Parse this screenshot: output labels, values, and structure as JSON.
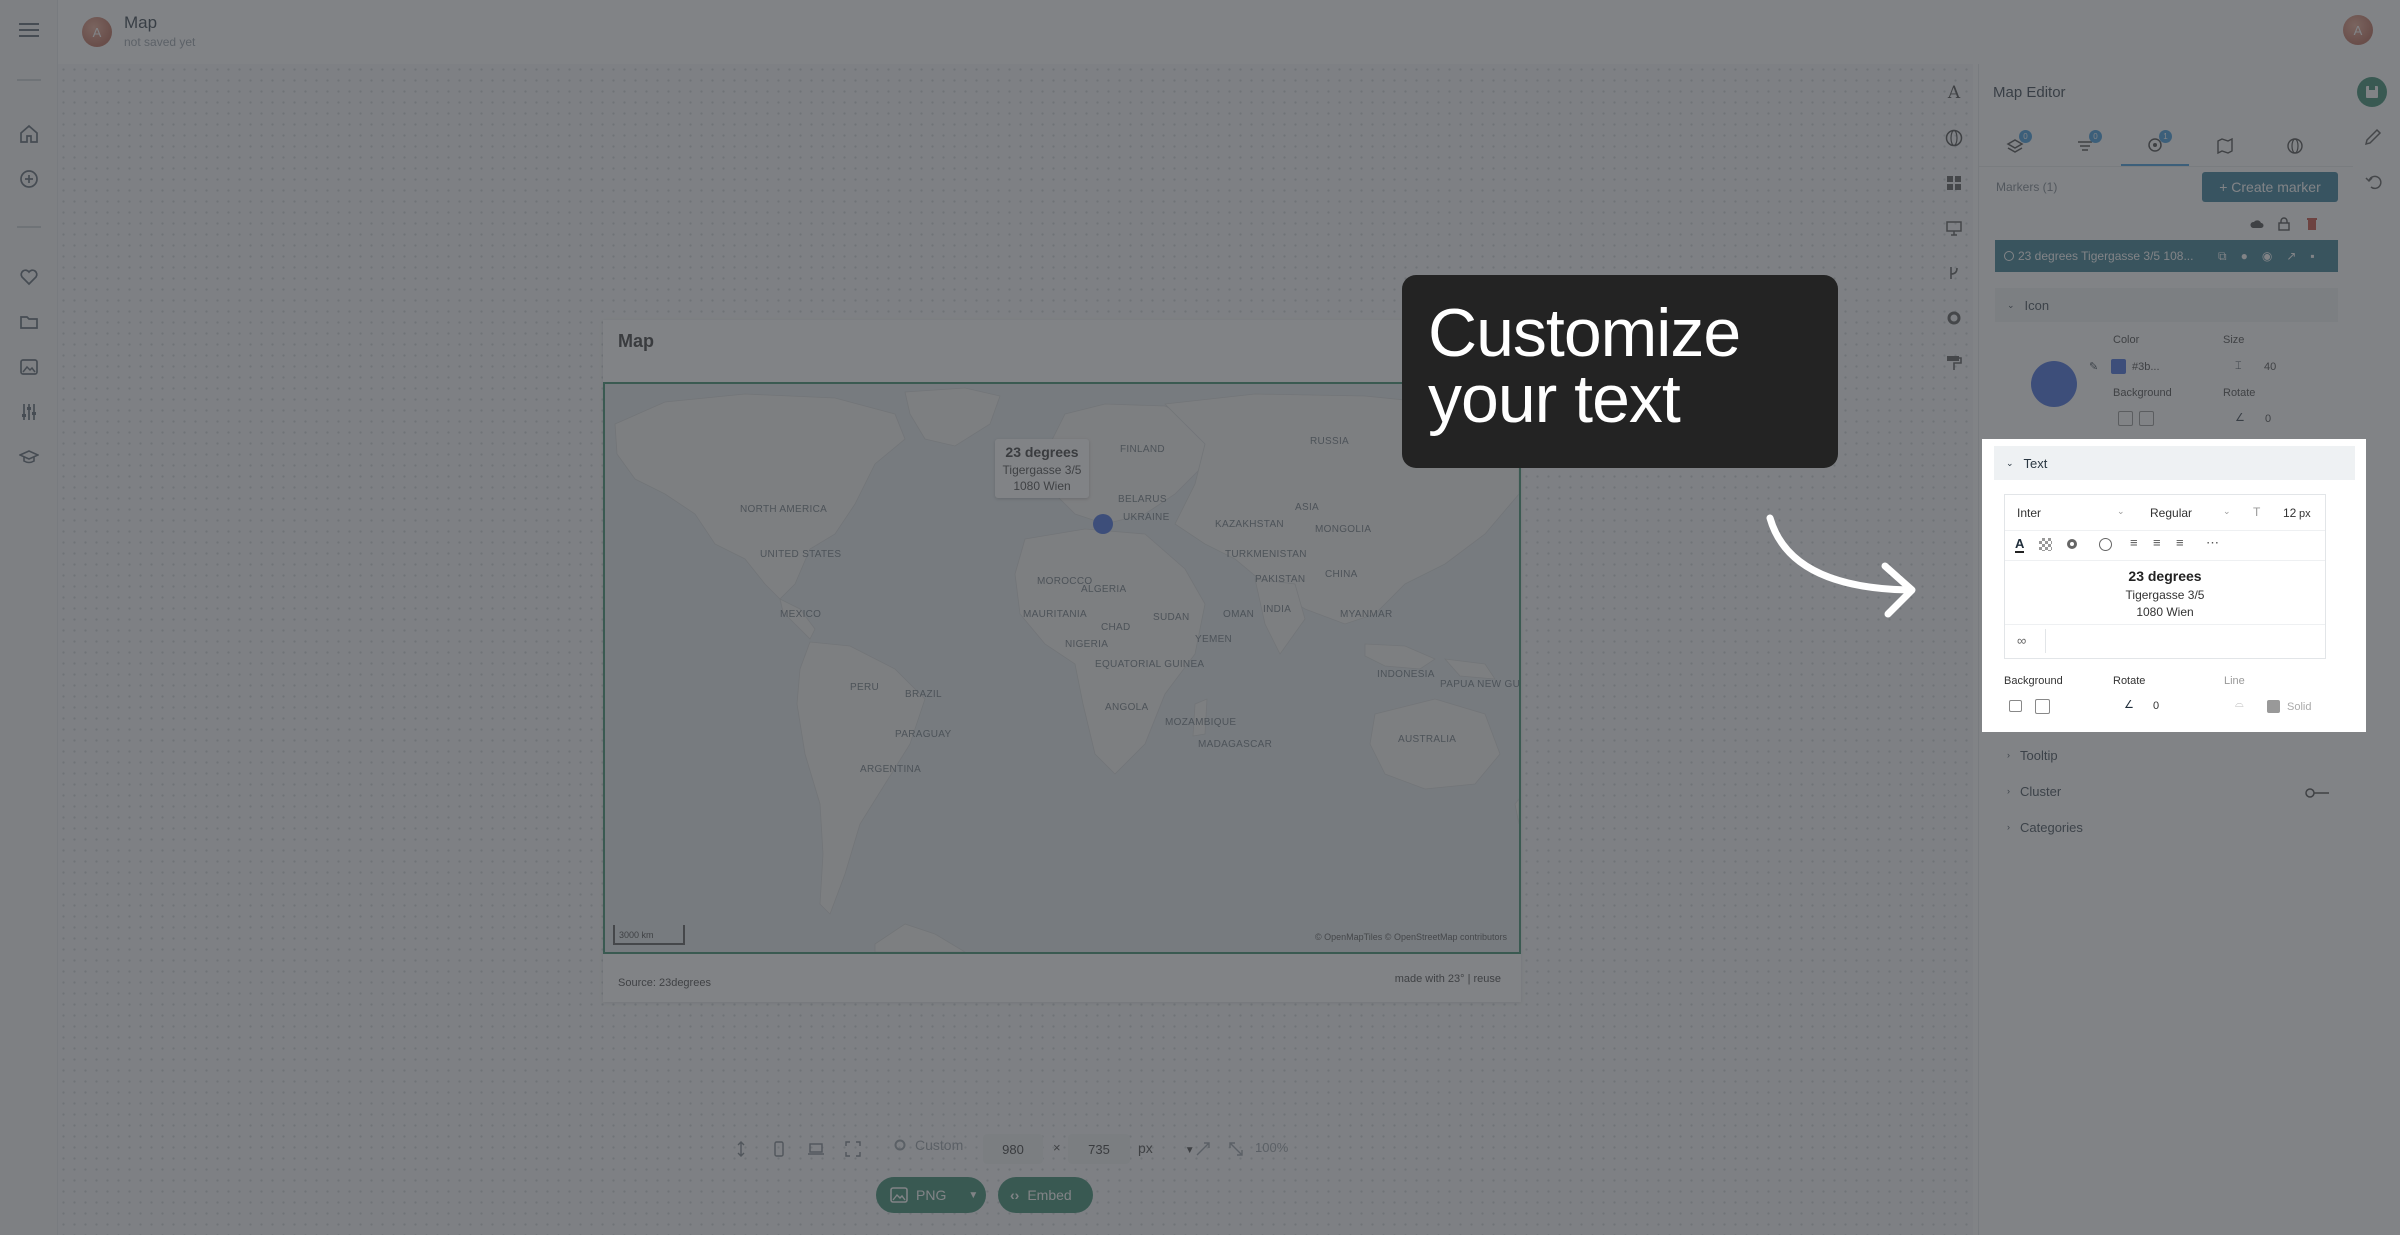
{
  "app": {
    "doc_title": "Map",
    "doc_subtitle": "not saved yet",
    "user_initial": "A"
  },
  "map_card": {
    "title": "Map",
    "marker_tooltip": {
      "line1": "23 degrees",
      "line2": "Tigergasse 3/5",
      "line3": "1080 Wien"
    },
    "scale": "3000 km",
    "attribution": "© OpenMapTiles © OpenStreetMap contributors",
    "source": "Source: 23degrees",
    "made_with": "made with 23° | reuse",
    "country_labels": [
      "RUSSIA",
      "NORTH AMERICA",
      "UNITED STATES",
      "MEXICO",
      "PERU",
      "BRAZIL",
      "PARAGUAY",
      "ARGENTINA",
      "FINLAND",
      "BELARUS",
      "UKRAINE",
      "KAZAKHSTAN",
      "MONGOLIA",
      "ASIA",
      "CHINA",
      "INDIA",
      "MAURITANIA",
      "CHAD",
      "SUDAN",
      "NIGERIA",
      "EQUATORIAL GUINEA",
      "ANGOLA",
      "MOZAMBIQUE",
      "MADAGASCAR",
      "AUSTRALIA",
      "MOROCCO",
      "ALGERIA",
      "TURKMENISTAN",
      "PAKISTAN",
      "MYANMAR",
      "OMAN",
      "YEMEN",
      "INDONESIA",
      "PAPUA NEW GUINEA"
    ]
  },
  "bottom_toolbar": {
    "size_preset": "Custom",
    "width": "980",
    "times": "×",
    "height": "735",
    "unit": "px",
    "zoom": "100%",
    "export_format": "PNG",
    "embed_label": "Embed"
  },
  "editor": {
    "title": "Map Editor",
    "tabs": [
      {
        "icon": "layers-icon",
        "badge": "0"
      },
      {
        "icon": "filter-icon",
        "badge": "0"
      },
      {
        "icon": "marker-icon",
        "badge": "1"
      },
      {
        "icon": "basemap-icon",
        "badge": ""
      },
      {
        "icon": "globe-icon",
        "badge": ""
      }
    ],
    "markers_label": "Markers (1)",
    "create_marker": "+ Create marker",
    "marker_row_label": "23 degrees Tigergasse 3/5 108...",
    "icon_section": {
      "title": "Icon",
      "color_label": "Color",
      "color_value": "#3b...",
      "size_label": "Size",
      "size_value": "40",
      "background_label": "Background",
      "rotate_label": "Rotate",
      "rotate_value": "0",
      "marker_color": "#2e5bd8"
    },
    "text_section": {
      "title": "Text",
      "font": "Inter",
      "weight": "Regular",
      "font_size": "12",
      "font_unit": "px",
      "content_line1": "23 degrees",
      "content_line2": "Tigergasse 3/5",
      "content_line3": "1080 Wien",
      "background_label": "Background",
      "rotate_label": "Rotate",
      "rotate_value": "0",
      "line_label": "Line",
      "line_style": "Solid"
    },
    "collapsed_sections": [
      "Tooltip",
      "Cluster",
      "Categories"
    ]
  },
  "callout": {
    "line1": "Customize",
    "line2": "your text"
  },
  "colors": {
    "accent_green": "#1f7e5f",
    "accent_teal": "#1d6c8c",
    "marker_blue": "#2e5bd8",
    "overlay": "rgba(70,72,76,0.68)"
  }
}
